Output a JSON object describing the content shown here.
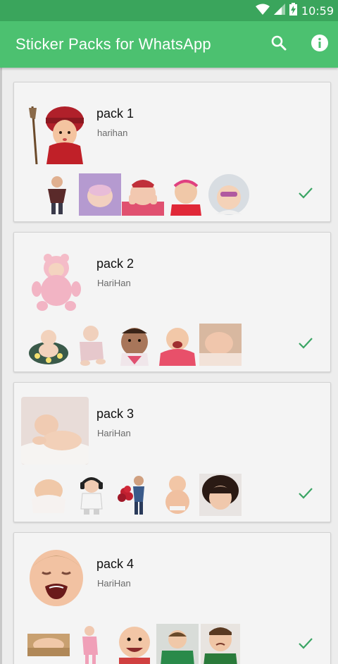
{
  "status_bar": {
    "time": "10:59"
  },
  "app_bar": {
    "title": "Sticker Packs for WhatsApp"
  },
  "colors": {
    "primary": "#4cc170",
    "status_bar": "#3aa55c",
    "check": "#3aa564"
  },
  "packs": [
    {
      "name": "pack 1",
      "author": "harihan",
      "stickers": [
        "baby-doll",
        "sleeping-baby-purple",
        "baby-pink-hands",
        "baby-headband",
        "baby-sunglasses"
      ]
    },
    {
      "name": "pack 2",
      "author": "HariHan",
      "stickers": [
        "baby-in-flowerpot",
        "crawling-baby",
        "baby-bib",
        "laughing-baby",
        "baby-sleeping-arm"
      ]
    },
    {
      "name": "pack 3",
      "author": "HariHan",
      "stickers": [
        "baby-towel",
        "baby-headphones",
        "boy-with-roses",
        "chubby-baby",
        "baby-messy-hair"
      ]
    },
    {
      "name": "pack 4",
      "author": "HariHan",
      "stickers": [
        "baby-sleeping-bed",
        "baby-pink-outfit",
        "smiling-baby",
        "toddler-green-shirt",
        "pouting-toddler"
      ]
    }
  ]
}
